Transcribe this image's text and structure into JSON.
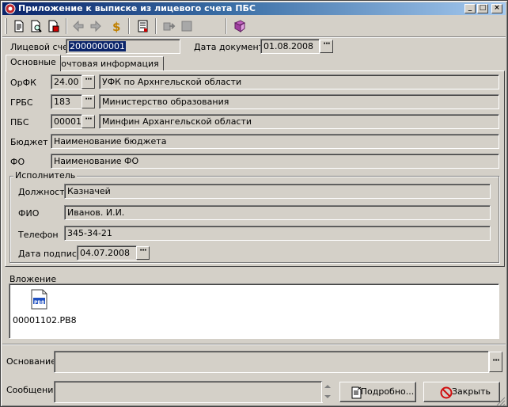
{
  "window": {
    "title": "Приложение к выписке из лицевого счета ПБС",
    "min_label": "_",
    "max_label": "□",
    "close_label": "×"
  },
  "toolbar": {
    "icons": [
      "new-doc-icon",
      "preview-icon",
      "copy-doc-icon",
      "dollar-icon",
      "back-arrow-icon",
      "forward-arrow-icon",
      "form-icon",
      "export-icon",
      "stop-icon",
      "book-icon"
    ]
  },
  "header": {
    "account_label": "Лицевой счет",
    "account_value": "2000000001",
    "docdate_label": "Дата документа",
    "docdate_value": "01.08.2008"
  },
  "tabs": [
    "Основные",
    "Почтовая информация"
  ],
  "main": {
    "orfk_label": "ОрФК",
    "orfk_code": "24.00",
    "orfk_name": "УФК по Архнгельской области",
    "grbs_label": "ГРБС",
    "grbs_code": "183",
    "grbs_name": "Министерство образования",
    "pbs_label": "ПБС",
    "pbs_code": "00001",
    "pbs_name": "Минфин Архангельской области",
    "budget_label": "Бюджет",
    "budget_value": "Наименование бюджета",
    "fo_label": "ФО",
    "fo_value": "Наименование ФО"
  },
  "executor": {
    "group_title": "Исполнитель",
    "position_label": "Должность",
    "position_value": "Казначей",
    "fio_label": "ФИО",
    "fio_value": "Иванов. И.И.",
    "phone_label": "Телефон",
    "phone_value": "345-34-21",
    "signdate_label": "Дата подписи",
    "signdate_value": "04.07.2008"
  },
  "attachment": {
    "label": "Вложение",
    "file_name": "00001102.PB8",
    "file_icon_text": "PB8"
  },
  "footer": {
    "basis_label": "Основание",
    "basis_value": "",
    "message_label": "Сообщение",
    "message_value": "",
    "details_button": "Подробно...",
    "close_button": "Закрыть"
  },
  "dots_label": "···"
}
